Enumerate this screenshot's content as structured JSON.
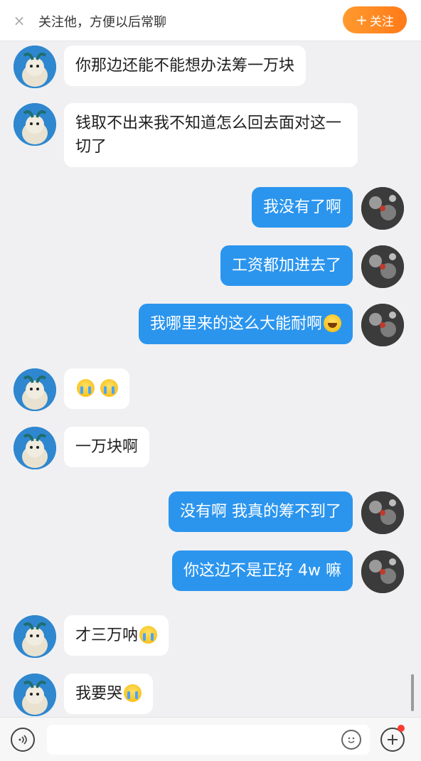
{
  "banner": {
    "close_icon": "×",
    "text": "关注他，方便以后常聊",
    "follow_plus": "+",
    "follow_label": "关注"
  },
  "messages": [
    {
      "side": "in",
      "text": "你那边还能不能想办法筹一万块"
    },
    {
      "side": "in",
      "text": "钱取不出来我不知道怎么回去面对这一切了"
    },
    {
      "side": "out",
      "text": "我没有了啊"
    },
    {
      "side": "out",
      "text": "工资都加进去了"
    },
    {
      "side": "out",
      "text": "我哪里来的这么大能耐啊",
      "emoji": "laugh-emoji"
    },
    {
      "side": "in",
      "text": "",
      "emoji": "cry-emoji x2"
    },
    {
      "side": "in",
      "text": "一万块啊"
    },
    {
      "side": "out",
      "text": "没有啊 我真的筹不到了"
    },
    {
      "side": "out",
      "text": "你这边不是正好 4w 嘛"
    },
    {
      "side": "in",
      "text": "才三万呐",
      "emoji": "cry-emoji"
    },
    {
      "side": "in",
      "text": "我要哭",
      "emoji": "sob-emoji"
    }
  ],
  "input_bar": {
    "voice_icon": "voice-icon",
    "emoji_icon": "emoji-icon",
    "plus_icon": "plus-icon",
    "input_placeholder": ""
  },
  "colors": {
    "follow_button": "#ff8a1f",
    "outgoing_bubble": "#2b95ee",
    "incoming_bubble": "#ffffff",
    "background": "#f0f0f2",
    "notification_dot": "#ff3b30"
  }
}
